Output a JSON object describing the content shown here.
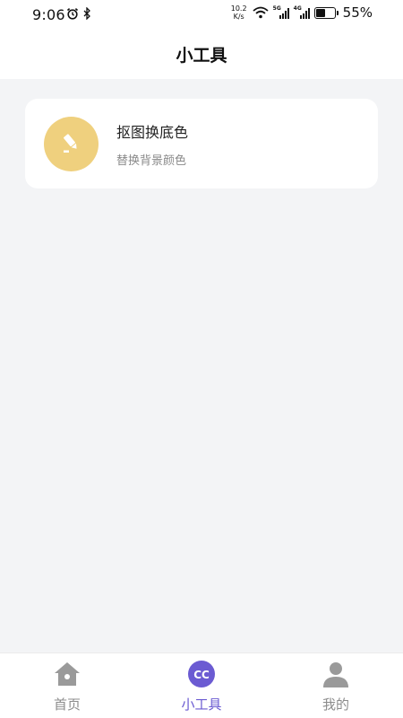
{
  "status_bar": {
    "time": "9:06",
    "net_speed_value": "10.2",
    "net_speed_unit": "K/s",
    "signal1_tag": "5G",
    "signal2_tag": "4G",
    "battery_percent": "55%",
    "battery_level": 0.55
  },
  "header": {
    "title": "小工具"
  },
  "tools": [
    {
      "title": "抠图换底色",
      "subtitle": "替换背景颜色",
      "icon": "pen-icon"
    }
  ],
  "tabbar": {
    "tabs": [
      {
        "label": "首页",
        "icon": "home-icon",
        "active": false
      },
      {
        "label": "小工具",
        "icon": "cc-icon",
        "active": true
      },
      {
        "label": "我的",
        "icon": "user-icon",
        "active": false
      }
    ]
  },
  "colors": {
    "accent": "#6b5bd2",
    "tool_icon_bg": "#efd07e",
    "page_bg": "#f3f4f6"
  }
}
